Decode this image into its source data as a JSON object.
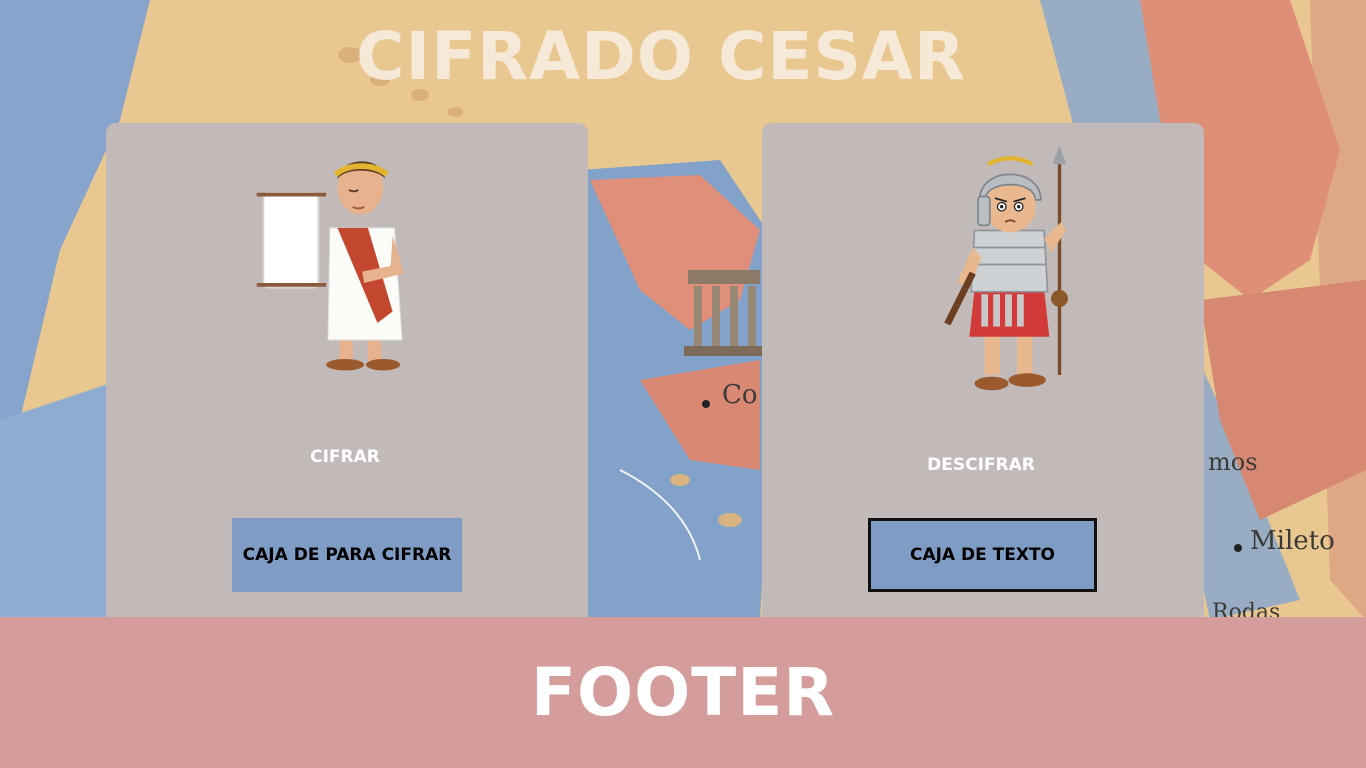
{
  "header": {
    "title": "CIFRADO CESAR"
  },
  "map": {
    "labels": [
      "Co",
      "mos",
      "Mileto",
      "Rodas"
    ]
  },
  "cards": {
    "encrypt": {
      "label": "CIFRAR",
      "button": "CAJA DE  PARA CIFRAR"
    },
    "decrypt": {
      "label": "DESCIFRAR",
      "button": "CAJA DE TEXTO"
    }
  },
  "footer": {
    "text": "FOOTER"
  },
  "colors": {
    "card": "#c2bab8",
    "button": "#7e9cc4",
    "footer": "#d49d9b",
    "sea": "#7f9fc8",
    "land": "#e8c890"
  }
}
